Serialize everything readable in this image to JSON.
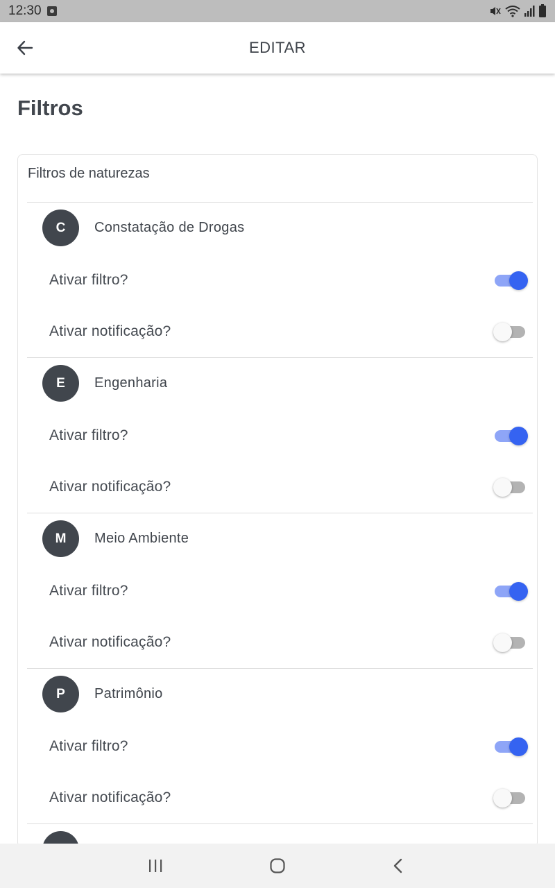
{
  "status_bar": {
    "time": "12:30",
    "icons": [
      "notification-icon",
      "mute-icon",
      "wifi-icon",
      "signal-icon",
      "battery-icon"
    ]
  },
  "app_bar": {
    "back_icon": "arrow-left-icon",
    "title": "EDITAR"
  },
  "page": {
    "title": "Filtros"
  },
  "card": {
    "header": "Filtros de naturezas",
    "groups": [
      {
        "initial": "C",
        "name": "Constatação de Drogas",
        "filter_label": "Ativar filtro?",
        "filter_on": true,
        "notif_label": "Ativar notificação?",
        "notif_on": false
      },
      {
        "initial": "E",
        "name": "Engenharia",
        "filter_label": "Ativar filtro?",
        "filter_on": true,
        "notif_label": "Ativar notificação?",
        "notif_on": false
      },
      {
        "initial": "M",
        "name": "Meio Ambiente",
        "filter_label": "Ativar filtro?",
        "filter_on": true,
        "notif_label": "Ativar notificação?",
        "notif_on": false
      },
      {
        "initial": "P",
        "name": "Patrimônio",
        "filter_label": "Ativar filtro?",
        "filter_on": true,
        "notif_label": "Ativar notificação?",
        "notif_on": false
      }
    ]
  },
  "colors": {
    "switch_on_thumb": "#3563f1",
    "switch_on_track": "#8ea5f7",
    "switch_off_thumb": "#f9f9f9",
    "switch_off_track": "#b3b3b3",
    "avatar": "#41464d"
  },
  "nav_bar": {
    "buttons": [
      "recent-apps-icon",
      "home-icon",
      "back-icon"
    ]
  }
}
